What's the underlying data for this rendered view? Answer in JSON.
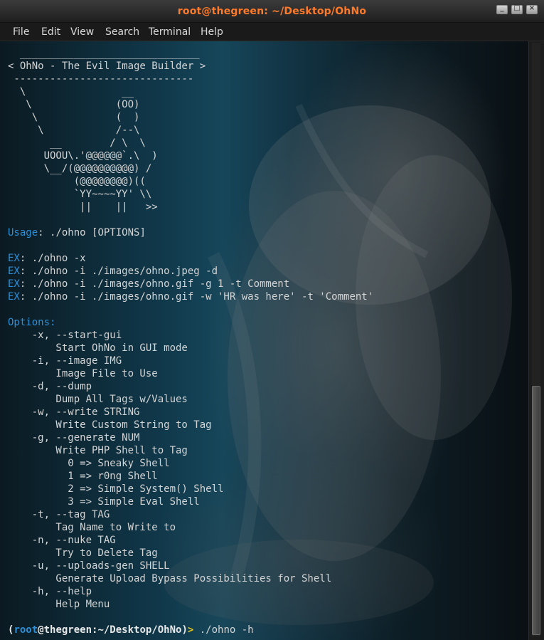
{
  "window": {
    "title": "root@thegreen: ~/Desktop/OhNo",
    "accent_color": "#ff7a2a"
  },
  "menu": {
    "items": [
      "File",
      "Edit",
      "View",
      "Search",
      "Terminal",
      "Help"
    ]
  },
  "terminal": {
    "lines": [
      [
        {
          "t": "  ______________________________"
        }
      ],
      [
        {
          "t": "< OhNo - The Evil Image Builder >"
        }
      ],
      [
        {
          "t": " ------------------------------"
        }
      ],
      [
        {
          "t": "  \\                __"
        }
      ],
      [
        {
          "t": "   \\              (OO)"
        }
      ],
      [
        {
          "t": "    \\             (  )"
        }
      ],
      [
        {
          "t": "     \\            /--\\"
        }
      ],
      [
        {
          "t": "       __        / \\  \\"
        }
      ],
      [
        {
          "t": "      UOOU\\.'@@@@@@`.\\  )"
        }
      ],
      [
        {
          "t": "      \\__/(@@@@@@@@@@) /"
        }
      ],
      [
        {
          "t": "           (@@@@@@@@)(("
        }
      ],
      [
        {
          "t": "           `YY~~~~YY' \\\\"
        }
      ],
      [
        {
          "t": "            ||    ||   >>"
        }
      ],
      [
        {
          "t": ""
        }
      ],
      [
        {
          "t": "Usage",
          "c": "blue"
        },
        {
          "t": ": ./ohno [OPTIONS]"
        }
      ],
      [
        {
          "t": ""
        }
      ],
      [
        {
          "t": "EX",
          "c": "blue"
        },
        {
          "t": ": ./ohno -x"
        }
      ],
      [
        {
          "t": "EX",
          "c": "blue"
        },
        {
          "t": ": ./ohno -i ./images/ohno.jpeg -d"
        }
      ],
      [
        {
          "t": "EX",
          "c": "blue"
        },
        {
          "t": ": ./ohno -i ./images/ohno.gif -g 1 -t Comment"
        }
      ],
      [
        {
          "t": "EX",
          "c": "blue"
        },
        {
          "t": ": ./ohno -i ./images/ohno.gif -w 'HR was here' -t 'Comment'"
        }
      ],
      [
        {
          "t": ""
        }
      ],
      [
        {
          "t": "Options:",
          "c": "blue"
        }
      ],
      [
        {
          "t": "    -x, --start-gui"
        }
      ],
      [
        {
          "t": "        Start OhNo in GUI mode"
        }
      ],
      [
        {
          "t": "    -i, --image IMG"
        }
      ],
      [
        {
          "t": "        Image File to Use"
        }
      ],
      [
        {
          "t": "    -d, --dump"
        }
      ],
      [
        {
          "t": "        Dump All Tags w/Values"
        }
      ],
      [
        {
          "t": "    -w, --write STRING"
        }
      ],
      [
        {
          "t": "        Write Custom String to Tag"
        }
      ],
      [
        {
          "t": "    -g, --generate NUM"
        }
      ],
      [
        {
          "t": "        Write PHP Shell to Tag"
        }
      ],
      [
        {
          "t": "          0 => Sneaky Shell"
        }
      ],
      [
        {
          "t": "          1 => r0ng Shell"
        }
      ],
      [
        {
          "t": "          2 => Simple System() Shell"
        }
      ],
      [
        {
          "t": "          3 => Simple Eval Shell"
        }
      ],
      [
        {
          "t": "    -t, --tag TAG"
        }
      ],
      [
        {
          "t": "        Tag Name to Write to"
        }
      ],
      [
        {
          "t": "    -n, --nuke TAG"
        }
      ],
      [
        {
          "t": "        Try to Delete Tag"
        }
      ],
      [
        {
          "t": "    -u, --uploads-gen SHELL"
        }
      ],
      [
        {
          "t": "        Generate Upload Bypass Possibilities for Shell"
        }
      ],
      [
        {
          "t": "    -h, --help"
        }
      ],
      [
        {
          "t": "        Help Menu"
        }
      ],
      [
        {
          "t": ""
        }
      ],
      [
        {
          "t": "(",
          "c": "prompt-bold"
        },
        {
          "t": "root",
          "c": "prompt-user"
        },
        {
          "t": "@thegreen:~/Desktop/OhNo)",
          "c": "prompt-host"
        },
        {
          "t": "> ",
          "c": "prompt-arrow"
        },
        {
          "t": "./ohno -h"
        }
      ]
    ]
  },
  "colors": {
    "label_blue": "#2f8fd6",
    "prompt_arrow": "#e6c21a",
    "text": "#d4d4d4"
  },
  "icons": [
    "minimize-icon",
    "maximize-icon",
    "close-icon"
  ]
}
